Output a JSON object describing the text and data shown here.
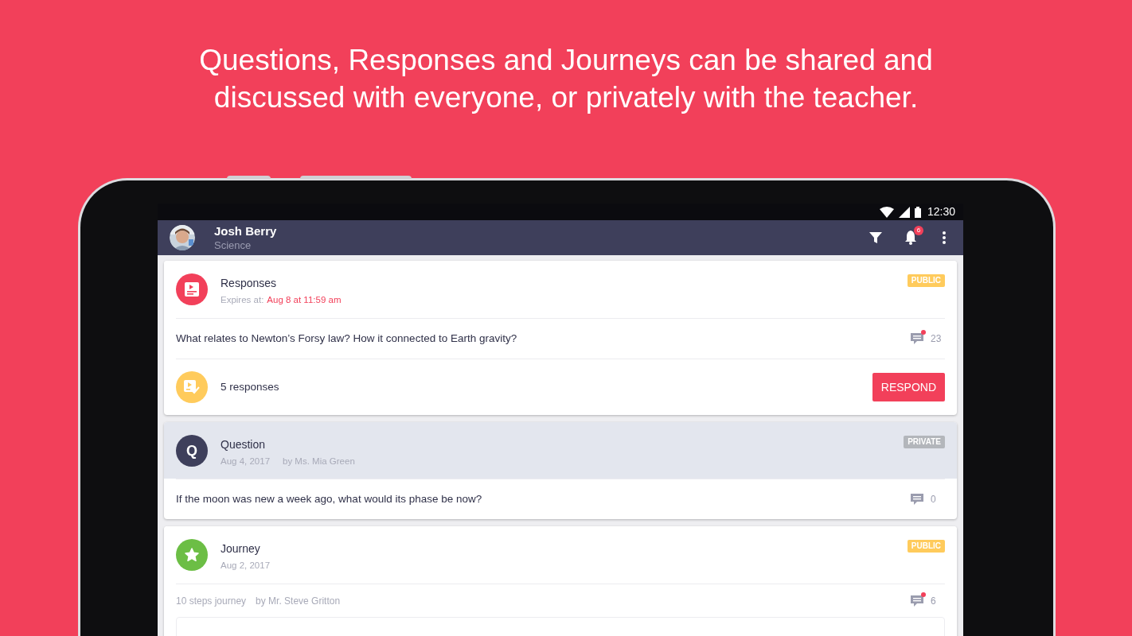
{
  "headline": "Questions, Responses and Journeys can be shared and discussed with everyone, or privately with the teacher.",
  "status_bar": {
    "time": "12:30"
  },
  "app_bar": {
    "name": "Josh Berry",
    "subject": "Science",
    "notification_count": "6"
  },
  "cards": [
    {
      "kind": "responses",
      "selected": false,
      "title": "Responses",
      "meta": [
        {
          "kind": "label",
          "text": "Expires at:"
        },
        {
          "kind": "deadline",
          "text": "Aug 8 at 11:59 am"
        }
      ],
      "badge": {
        "text": "PUBLIC",
        "color": "#ffcb5c"
      },
      "rows": [
        {
          "kind": "question",
          "text": "What relates to Newton’s Forsy law? How it connected to Earth gravity?",
          "comments": "23",
          "unread": true
        }
      ],
      "footer": {
        "text": "5 responses",
        "button": "RESPOND"
      }
    },
    {
      "kind": "question",
      "selected": true,
      "title": "Question",
      "avatar_letter": "Q",
      "meta": [
        {
          "kind": "plain",
          "text": "Aug 4, 2017"
        },
        {
          "kind": "plain",
          "text": "by Ms. Mia Green"
        }
      ],
      "badge": {
        "text": "PRIVATE",
        "color": "#b3b6bb"
      },
      "rows": [
        {
          "kind": "question",
          "text": "If the moon was new a week ago, what would its phase be now?",
          "comments": "0",
          "unread": false
        }
      ]
    },
    {
      "kind": "journey",
      "selected": false,
      "title": "Journey",
      "meta": [
        {
          "kind": "plain",
          "text": "Aug 2, 2017"
        }
      ],
      "badge": {
        "text": "PUBLIC",
        "color": "#ffcb5c"
      },
      "rows": [
        {
          "kind": "info",
          "parts": [
            "10 steps journey",
            "by Mr. Steve Gritton"
          ],
          "comments": "6",
          "unread": true
        }
      ],
      "nested_preview": true
    }
  ]
}
